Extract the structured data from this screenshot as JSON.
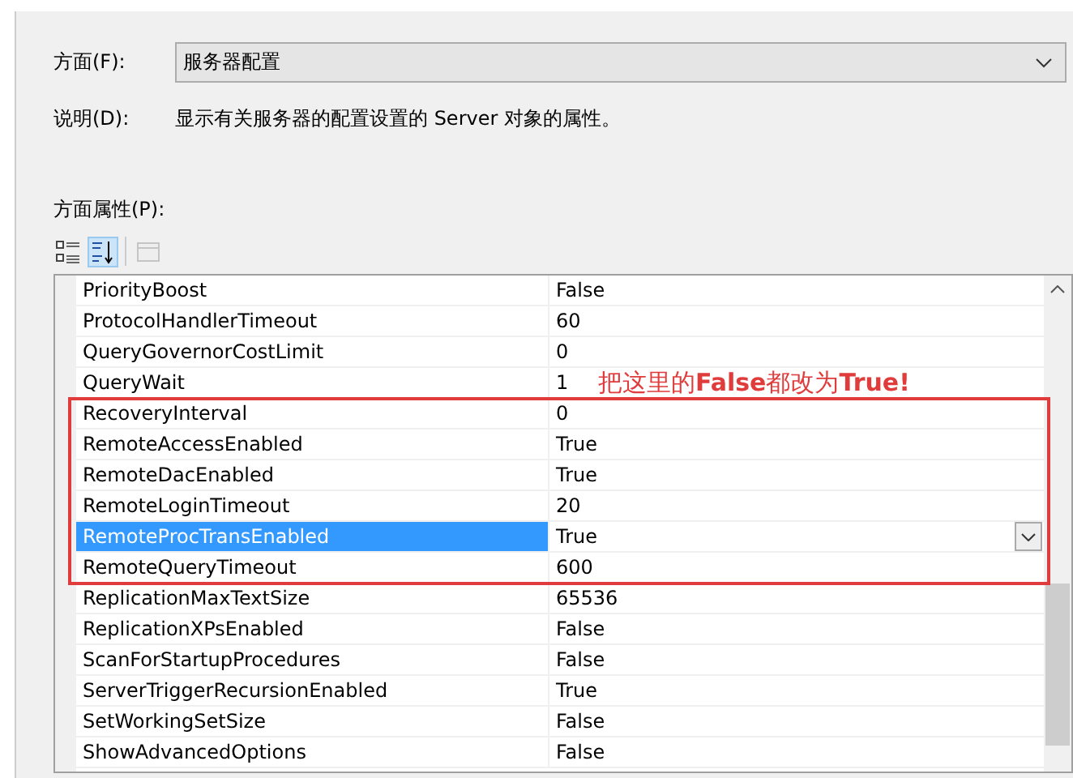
{
  "facet": {
    "label": "方面(F):",
    "value": "服务器配置"
  },
  "description": {
    "label": "说明(D):",
    "text": "显示有关服务器的配置设置的 Server 对象的属性。"
  },
  "properties_label": "方面属性(P):",
  "toolbar": [
    {
      "kind": "categorized",
      "selected": false,
      "disabled": false
    },
    {
      "kind": "alphabetical",
      "selected": true,
      "disabled": false
    },
    {
      "kind": "pages",
      "selected": false,
      "disabled": true
    }
  ],
  "properties": [
    {
      "name": "PriorityBoost",
      "value": "False",
      "selected": false
    },
    {
      "name": "ProtocolHandlerTimeout",
      "value": "60",
      "selected": false
    },
    {
      "name": "QueryGovernorCostLimit",
      "value": "0",
      "selected": false
    },
    {
      "name": "QueryWait",
      "value": "1",
      "selected": false
    },
    {
      "name": "RecoveryInterval",
      "value": "0",
      "selected": false
    },
    {
      "name": "RemoteAccessEnabled",
      "value": "True",
      "selected": false
    },
    {
      "name": "RemoteDacEnabled",
      "value": "True",
      "selected": false
    },
    {
      "name": "RemoteLoginTimeout",
      "value": "20",
      "selected": false
    },
    {
      "name": "RemoteProcTransEnabled",
      "value": "True",
      "selected": true
    },
    {
      "name": "RemoteQueryTimeout",
      "value": "600",
      "selected": false
    },
    {
      "name": "ReplicationMaxTextSize",
      "value": "65536",
      "selected": false
    },
    {
      "name": "ReplicationXPsEnabled",
      "value": "False",
      "selected": false
    },
    {
      "name": "ScanForStartupProcedures",
      "value": "False",
      "selected": false
    },
    {
      "name": "ServerTriggerRecursionEnabled",
      "value": "True",
      "selected": false
    },
    {
      "name": "SetWorkingSetSize",
      "value": "False",
      "selected": false
    },
    {
      "name": "ShowAdvancedOptions",
      "value": "False",
      "selected": false
    }
  ],
  "annotation": {
    "text": "把这里的**False**都改为**True!**"
  }
}
